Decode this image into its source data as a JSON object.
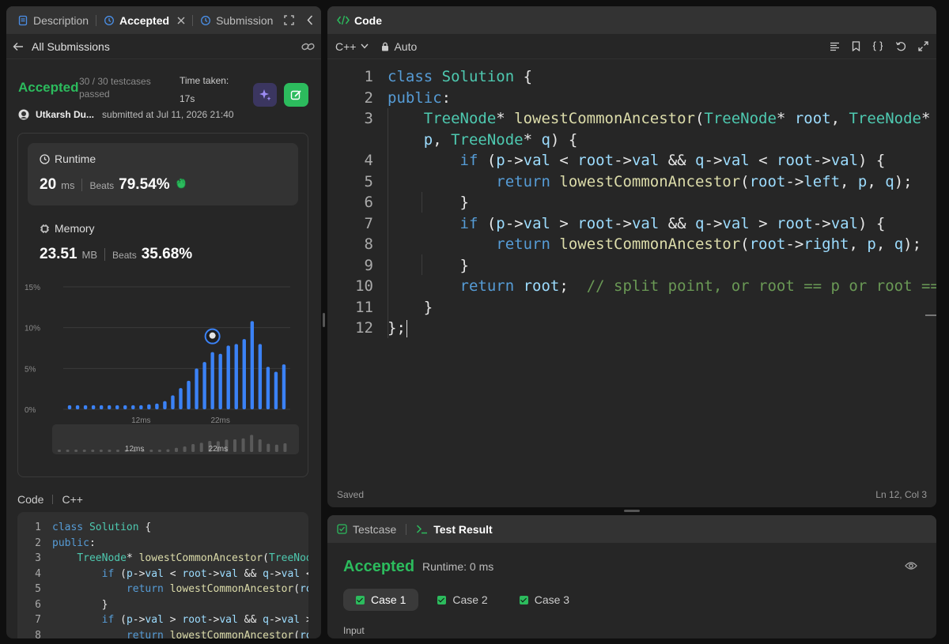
{
  "left": {
    "tabs": [
      {
        "label": "Description"
      },
      {
        "label": "Accepted"
      },
      {
        "label": "Submission"
      }
    ],
    "back_label": "All Submissions",
    "status": "Accepted",
    "testcases_line1": "30 / 30 testcases",
    "testcases_line2": "passed",
    "time_taken_label": "Time taken:",
    "time_taken_value": "17s",
    "user_name": "Utkarsh Du...",
    "submitted_text": "submitted at Jul 11, 2026 21:40",
    "runtime": {
      "label": "Runtime",
      "value": "20",
      "unit": "ms",
      "beats_label": "Beats",
      "beats_value": "79.54%"
    },
    "memory": {
      "label": "Memory",
      "value": "23.51",
      "unit": "MB",
      "beats_label": "Beats",
      "beats_value": "35.68%"
    },
    "code_label": "Code",
    "code_lang": "C++",
    "code_lines": [
      {
        "n": "1",
        "t": "class Solution {"
      },
      {
        "n": "2",
        "t": "public:"
      },
      {
        "n": "3",
        "t": "    TreeNode* lowestCommonAncestor(TreeNode* root, TreeNode*"
      },
      {
        "n": "4",
        "t": "        if (p->val < root->val && q->val < root->val) {"
      },
      {
        "n": "5",
        "t": "            return lowestCommonAncestor(root->left, p, q);"
      },
      {
        "n": "6",
        "t": "        }"
      },
      {
        "n": "7",
        "t": "        if (p->val > root->val && q->val > root->val) {"
      },
      {
        "n": "8",
        "t": "            return lowestCommonAncestor(root->right, p, q);"
      }
    ]
  },
  "chart_data": {
    "type": "bar",
    "yticks": [
      "15%",
      "10%",
      "5%",
      "0%"
    ],
    "ylim": [
      0,
      15
    ],
    "xtick_labels": [
      {
        "label": "12ms",
        "index": 9
      },
      {
        "label": "22ms",
        "index": 19
      }
    ],
    "values": [
      0.5,
      0.5,
      0.5,
      0.5,
      0.5,
      0.5,
      0.5,
      0.5,
      0.5,
      0.5,
      0.6,
      0.7,
      1.0,
      1.7,
      2.6,
      3.5,
      5.0,
      5.8,
      7.0,
      6.8,
      7.8,
      8.0,
      8.6,
      10.8,
      8.0,
      5.2,
      4.6,
      5.5
    ],
    "highlight_index": 18,
    "minimap_tick_labels": [
      "12ms",
      "22ms"
    ]
  },
  "editor": {
    "title": "Code",
    "lang": "C++",
    "mode": "Auto",
    "status_left": "Saved",
    "status_right": "Ln 12, Col 3",
    "lines": [
      {
        "n": "1",
        "t": "class Solution {"
      },
      {
        "n": "2",
        "t": "public:"
      },
      {
        "n": "3",
        "t": "    TreeNode* lowestCommonAncestor(TreeNode* root, TreeNode*"
      },
      {
        "n": "",
        "t": "    p, TreeNode* q) {"
      },
      {
        "n": "4",
        "t": "        if (p->val < root->val && q->val < root->val) {"
      },
      {
        "n": "5",
        "t": "            return lowestCommonAncestor(root->left, p, q);"
      },
      {
        "n": "6",
        "t": "        }"
      },
      {
        "n": "7",
        "t": "        if (p->val > root->val && q->val > root->val) {"
      },
      {
        "n": "8",
        "t": "            return lowestCommonAncestor(root->right, p, q);"
      },
      {
        "n": "9",
        "t": "        }"
      },
      {
        "n": "10",
        "t": "        return root;  // split point, or root == p or root == q"
      },
      {
        "n": "11",
        "t": "    }"
      },
      {
        "n": "12",
        "t": "};"
      }
    ]
  },
  "test": {
    "tab1": "Testcase",
    "tab2": "Test Result",
    "status": "Accepted",
    "runtime": "Runtime: 0 ms",
    "cases": [
      "Case 1",
      "Case 2",
      "Case 3"
    ],
    "input_label": "Input"
  },
  "colors": {
    "accent_green": "#2cbb5d",
    "bar_blue": "#3b82f6"
  }
}
